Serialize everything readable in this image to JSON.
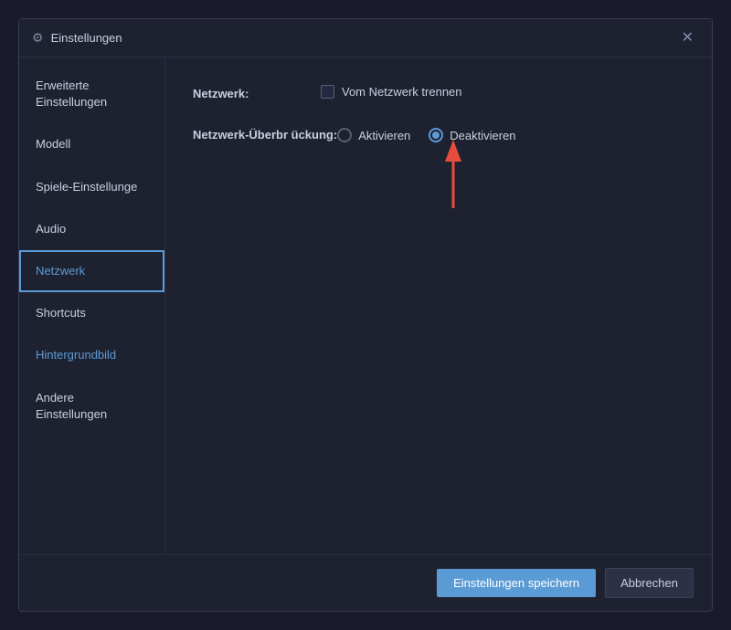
{
  "titleBar": {
    "title": "Einstellungen",
    "closeLabel": "✕"
  },
  "sidebar": {
    "items": [
      {
        "id": "erweiterte",
        "label": "Erweiterte Einstellungen",
        "state": "inactive"
      },
      {
        "id": "modell",
        "label": "Modell",
        "state": "inactive"
      },
      {
        "id": "spiele",
        "label": "Spiele-Einstellunge",
        "state": "inactive"
      },
      {
        "id": "audio",
        "label": "Audio",
        "state": "inactive"
      },
      {
        "id": "netzwerk",
        "label": "Netzwerk",
        "state": "active"
      },
      {
        "id": "shortcuts",
        "label": "Shortcuts",
        "state": "inactive"
      },
      {
        "id": "hintergrundbild",
        "label": "Hintergrundbild",
        "state": "inactive"
      },
      {
        "id": "andere",
        "label": "Andere Einstellungen",
        "state": "inactive"
      }
    ]
  },
  "content": {
    "netzwerkRow": {
      "label": "Netzwerk:",
      "checkboxLabel": "Vom Netzwerk trennen"
    },
    "uebertragungRow": {
      "label": "Netzwerk-Überbr ückung:",
      "options": [
        {
          "id": "aktivieren",
          "label": "Aktivieren",
          "selected": false
        },
        {
          "id": "deaktivieren",
          "label": "Deaktivieren",
          "selected": true
        }
      ]
    }
  },
  "footer": {
    "saveLabel": "Einstellungen speichern",
    "cancelLabel": "Abbrechen"
  }
}
